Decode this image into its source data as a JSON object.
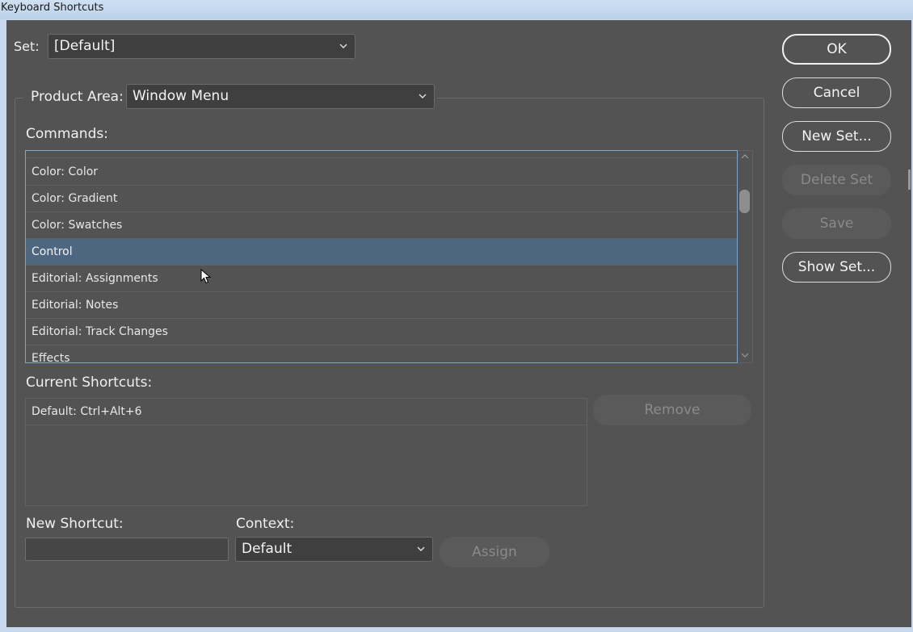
{
  "window": {
    "title": "Keyboard Shortcuts"
  },
  "set": {
    "label": "Set:",
    "value": "[Default]"
  },
  "product_area": {
    "label": "Product Area:",
    "value": "Window Menu"
  },
  "commands": {
    "label": "Commands:",
    "items": [
      {
        "label": "Color: Color",
        "selected": false
      },
      {
        "label": "Color: Gradient",
        "selected": false
      },
      {
        "label": "Color: Swatches",
        "selected": false
      },
      {
        "label": "Control",
        "selected": true
      },
      {
        "label": "Editorial: Assignments",
        "selected": false
      },
      {
        "label": "Editorial: Notes",
        "selected": false
      },
      {
        "label": "Editorial: Track Changes",
        "selected": false
      },
      {
        "label": "Effects",
        "selected": false
      }
    ]
  },
  "current_shortcuts": {
    "label": "Current Shortcuts:",
    "items": [
      {
        "label": "Default: Ctrl+Alt+6"
      }
    ],
    "remove_label": "Remove"
  },
  "new_shortcut": {
    "label": "New Shortcut:",
    "value": ""
  },
  "context": {
    "label": "Context:",
    "value": "Default"
  },
  "assign_label": "Assign",
  "buttons": {
    "ok": "OK",
    "cancel": "Cancel",
    "new_set": "New Set...",
    "delete_set": "Delete Set",
    "save": "Save",
    "show_set": "Show Set..."
  },
  "colors": {
    "panel_bg": "#535353",
    "selection": "#4e6781",
    "focus_border": "#7ea6cf",
    "disabled_text": "#8a8a8a"
  }
}
